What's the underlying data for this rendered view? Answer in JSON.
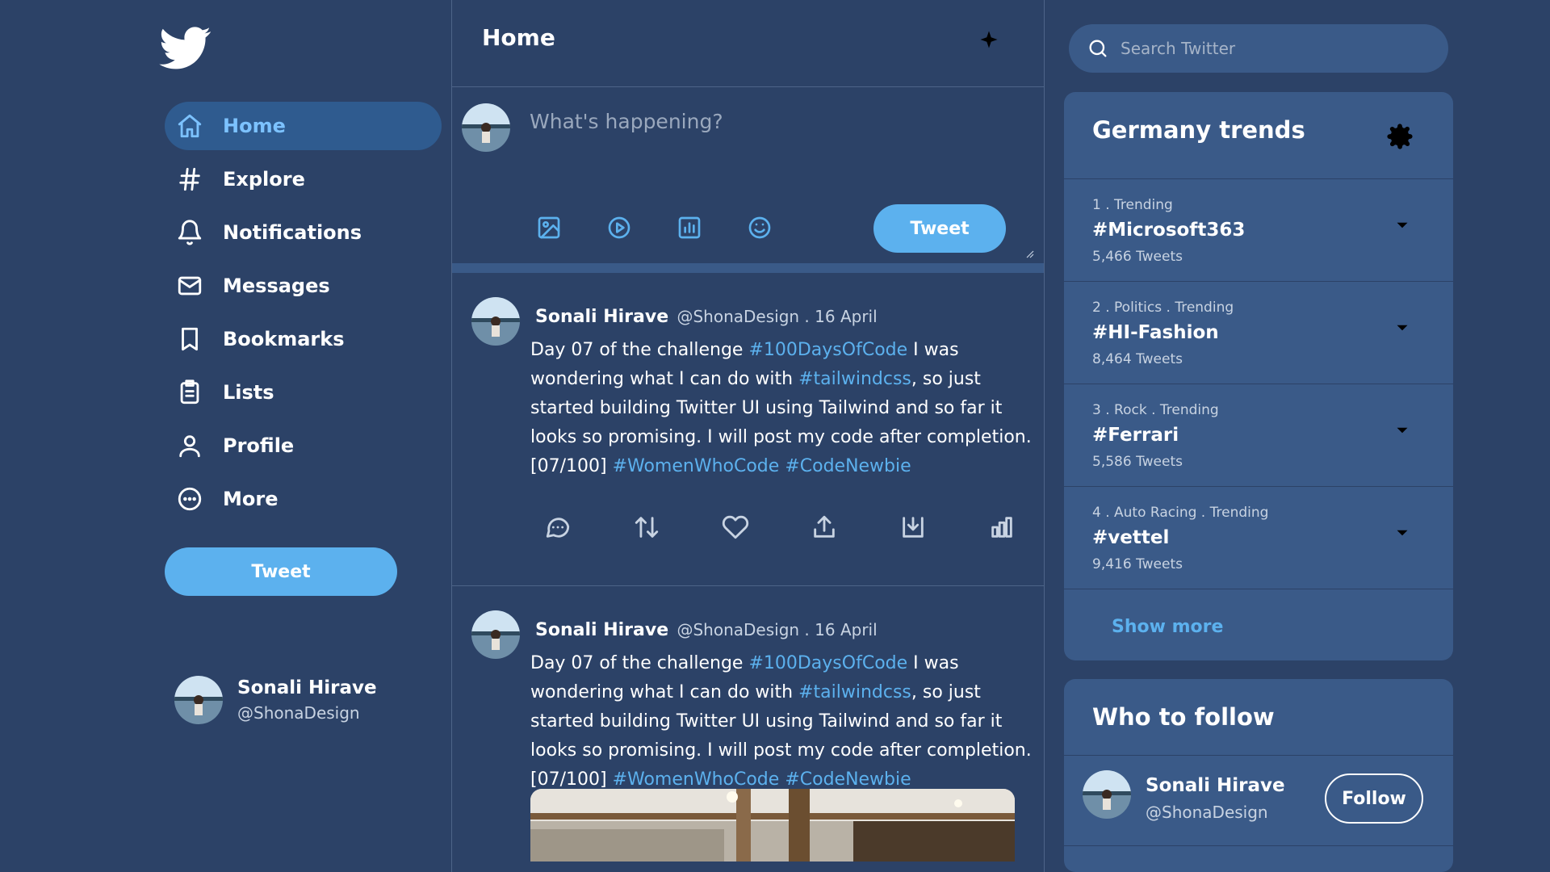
{
  "nav": {
    "items": [
      {
        "label": "Home",
        "icon": "home-icon"
      },
      {
        "label": "Explore",
        "icon": "hash-icon"
      },
      {
        "label": "Notifications",
        "icon": "bell-icon"
      },
      {
        "label": "Messages",
        "icon": "mail-icon"
      },
      {
        "label": "Bookmarks",
        "icon": "bookmark-icon"
      },
      {
        "label": "Lists",
        "icon": "clipboard-list-icon"
      },
      {
        "label": "Profile",
        "icon": "user-icon"
      },
      {
        "label": "More",
        "icon": "more-circle-icon"
      }
    ],
    "tweet_button": "Tweet"
  },
  "current_user": {
    "name": "Sonali Hirave",
    "handle": "@ShonaDesign"
  },
  "feed": {
    "title": "Home",
    "compose_placeholder": "What's happening?",
    "compose_tweet_button": "Tweet",
    "tweets": [
      {
        "name": "Sonali Hirave",
        "meta": "@ShonaDesign . 16 April",
        "text_1": "Day 07 of the challenge ",
        "tag_1": "#100DaysOfCode",
        "text_2": " I was wondering what I can do with ",
        "tag_2": "#tailwindcss",
        "text_3": ", so just started building Twitter UI using Tailwind and so far it looks so promising. I will post my code after completion. [07/100] ",
        "tag_3": "#WomenWhoCode",
        "tag_4": "#CodeNewbie"
      },
      {
        "name": "Sonali Hirave",
        "meta": "@ShonaDesign . 16 April",
        "text_1": "Day 07 of the challenge ",
        "tag_1": "#100DaysOfCode",
        "text_2": " I was wondering what I can do with ",
        "tag_2": "#tailwindcss",
        "text_3": ", so just started building Twitter UI using Tailwind and so far it looks so promising. I will post my code after completion. [07/100] ",
        "tag_3": "#WomenWhoCode",
        "tag_4": "#CodeNewbie"
      }
    ]
  },
  "search": {
    "placeholder": "Search Twitter"
  },
  "trends": {
    "title": "Germany trends",
    "items": [
      {
        "context": "1 . Trending",
        "tag": "#Microsoft363",
        "count": "5,466 Tweets"
      },
      {
        "context": "2 . Politics . Trending",
        "tag": "#HI-Fashion",
        "count": "8,464 Tweets"
      },
      {
        "context": "3 . Rock . Trending",
        "tag": "#Ferrari",
        "count": "5,586 Tweets"
      },
      {
        "context": "4 . Auto Racing . Trending",
        "tag": "#vettel",
        "count": "9,416 Tweets"
      }
    ],
    "show_more": "Show more"
  },
  "who_to_follow": {
    "title": "Who to follow",
    "items": [
      {
        "name": "Sonali Hirave",
        "handle": "@ShonaDesign",
        "button": "Follow"
      }
    ]
  },
  "colors": {
    "background": "#2c4267",
    "panel": "#3a5a88",
    "accent": "#5cb1ee",
    "active_nav": "#2f5b8f"
  }
}
